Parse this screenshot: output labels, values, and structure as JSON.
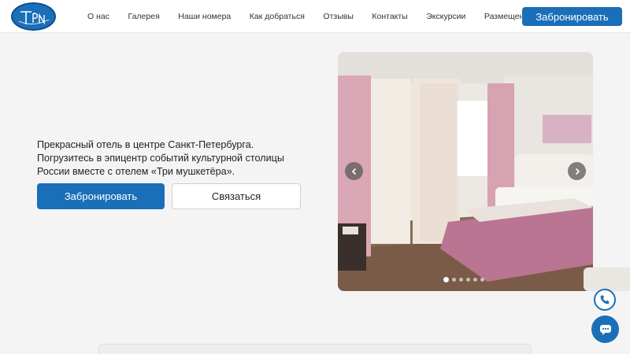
{
  "header": {
    "logo_icon": "hotel-logo-tri-mushketera",
    "nav": [
      {
        "label": "О нас"
      },
      {
        "label": "Галерея"
      },
      {
        "label": "Наши номера"
      },
      {
        "label": "Как добраться"
      },
      {
        "label": "Отзывы"
      },
      {
        "label": "Контакты"
      },
      {
        "label": "Экскурсии"
      },
      {
        "label": "Размещение групп"
      }
    ],
    "book_label": "Забронировать"
  },
  "hero": {
    "text": "Прекрасный отель в центре Санкт-Петербурга. Погрузитесь в эпицентр событий культурной столицы России вместе с отелем «Три мушкетёра».",
    "book_label": "Забронировать",
    "contact_label": "Связаться"
  },
  "slider": {
    "slide_count": 6,
    "active_slide": 1,
    "prev_icon": "chevron-left-icon",
    "next_icon": "chevron-right-icon"
  },
  "floating": {
    "phone_icon": "phone-icon",
    "chat_icon": "chat-icon"
  },
  "colors": {
    "primary": "#1a6fb8",
    "background": "#f4f4f4",
    "header_bg": "#ffffff"
  }
}
